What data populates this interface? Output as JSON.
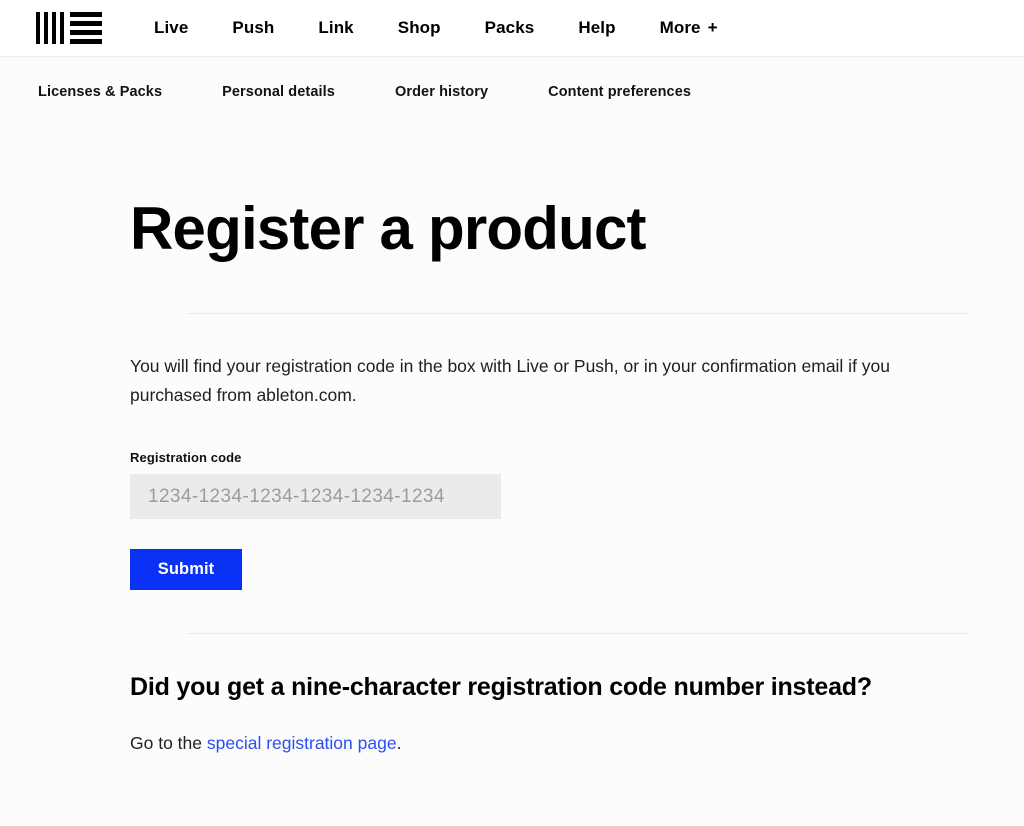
{
  "header": {
    "logo_name": "ableton-logo",
    "nav": [
      {
        "label": "Live"
      },
      {
        "label": "Push"
      },
      {
        "label": "Link"
      },
      {
        "label": "Shop"
      },
      {
        "label": "Packs"
      },
      {
        "label": "Help"
      },
      {
        "label": "More",
        "suffix": "+"
      }
    ]
  },
  "subnav": {
    "items": [
      {
        "label": "Licenses & Packs"
      },
      {
        "label": "Personal details"
      },
      {
        "label": "Order history"
      },
      {
        "label": "Content preferences"
      }
    ]
  },
  "main": {
    "title": "Register a product",
    "intro": "You will find your registration code in the box with Live or Push, or in your confirmation email if you purchased from ableton.com.",
    "form": {
      "label": "Registration code",
      "value": "",
      "placeholder": "1234-1234-1234-1234-1234-1234",
      "submit_label": "Submit"
    },
    "secondary": {
      "title": "Did you get a nine-character registration code number instead?",
      "text_before": "Go to the ",
      "link_label": "special registration page",
      "text_after": "."
    }
  },
  "colors": {
    "accent_blue": "#0b31f5",
    "link_blue": "#2a4ef5",
    "input_bg": "#ebebec",
    "page_bg": "#fcfcfd",
    "divider": "#e8e9ea"
  }
}
